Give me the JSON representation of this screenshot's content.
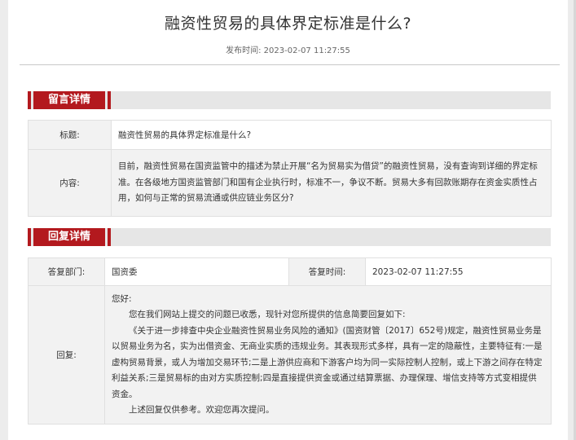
{
  "page": {
    "title": "融资性贸易的具体界定标准是什么?",
    "publish_label": "发布时间:",
    "publish_time": "2023-02-07 11:27:55"
  },
  "message": {
    "section_label": "留言详情",
    "title_label": "标题:",
    "title_value": "融资性贸易的具体界定标准是什么?",
    "content_label": "内容:",
    "content_value": "目前，融资性贸易在国资监管中的描述为禁止开展“名为贸易实为借贷”的融资性贸易，没有查询到详细的界定标准。在各级地方国资监管部门和国有企业执行时，标准不一，争议不断。贸易大多有回款账期存在资金实质性占用，如何与正常的贸易流通或供应链业务区分?"
  },
  "reply": {
    "section_label": "回复详情",
    "dept_label": "答复部门:",
    "dept_value": "国资委",
    "time_label": "答复时间:",
    "time_value": "2023-02-07 11:27:55",
    "reply_label": "回复:",
    "greeting": "您好:",
    "paragraph_1": "您在我们网站上提交的问题已收悉，现针对您所提供的信息简要回复如下:",
    "paragraph_2": "《关于进一步排查中央企业融资性贸易业务风险的通知》(国资财管〔2017〕652号)规定，融资性贸易业务是以贸易业务为名，实为出借资金、无商业实质的违规业务。其表现形式多样，具有一定的隐蔽性，主要特征有:一是虚构贸易背景，或人为增加交易环节;二是上游供应商和下游客户均为同一实际控制人控制，或上下游之间存在特定利益关系;三是贸易标的由对方实质控制;四是直接提供资金或通过结算票据、办理保理、增信支持等方式变相提供资金。",
    "paragraph_3": "上述回复仅供参考。欢迎您再次提问。"
  },
  "colors": {
    "accent": "#b3191e",
    "background": "#ececec",
    "label_cell": "#f2f2f2"
  }
}
